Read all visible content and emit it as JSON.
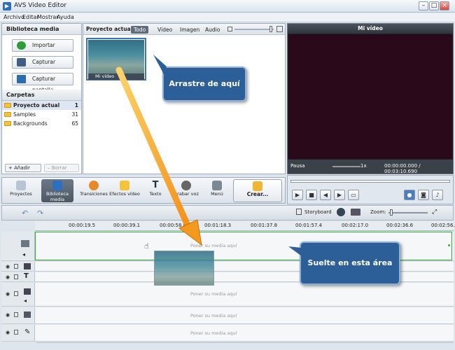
{
  "window": {
    "title": "AVS Video Editor"
  },
  "menu": [
    "Archivo",
    "Editar",
    "Mostrar",
    "Ayuda"
  ],
  "library": {
    "title": "Biblioteca media",
    "buttons": [
      "Importar",
      "Capturar",
      "Capturar pantalla"
    ],
    "folders_title": "Carpetas",
    "folders": [
      {
        "name": "Proyecto actual",
        "count": "1"
      },
      {
        "name": "Samples",
        "count": "31"
      },
      {
        "name": "Backgrounds",
        "count": "65"
      }
    ],
    "add_label": "Añadir",
    "delete_label": "Borrar"
  },
  "media": {
    "title": "Proyecto actual",
    "tabs": [
      "Todo",
      "Vídeo",
      "Imagen",
      "Audio"
    ],
    "active_tab": "Todo",
    "clip_name": "Mi vídeo"
  },
  "preview": {
    "title": "Mi vídeo",
    "status": "Pausa",
    "speed": "1x",
    "time": "00:00:00.000 / 00:03:10.690"
  },
  "toolbar": {
    "items": [
      "Proyectos",
      "Biblioteca media",
      "Transiciones",
      "Efectos vídeo",
      "Texto",
      "Grabar voz",
      "Menú",
      "Crear..."
    ],
    "active": "Biblioteca media"
  },
  "timeline": {
    "storyboard_label": "Storyboard",
    "zoom_label": "Zoom:",
    "ruler": [
      "00:00:19.5",
      "00:00:39.1",
      "00:00:58.6",
      "00:01:18.3",
      "00:01:37.8",
      "00:01:57.4",
      "00:02:17.0",
      "00:02:36.6",
      "00:02:56."
    ],
    "placeholder": "Poner su media aquí"
  },
  "callouts": {
    "drag_here": "Arrastre de aquí",
    "drop_here": "Suelte en esta área"
  },
  "colors": {
    "accent": "#2c5f97",
    "arrow": "#f39a1e",
    "drop_border": "#2fb12f"
  }
}
